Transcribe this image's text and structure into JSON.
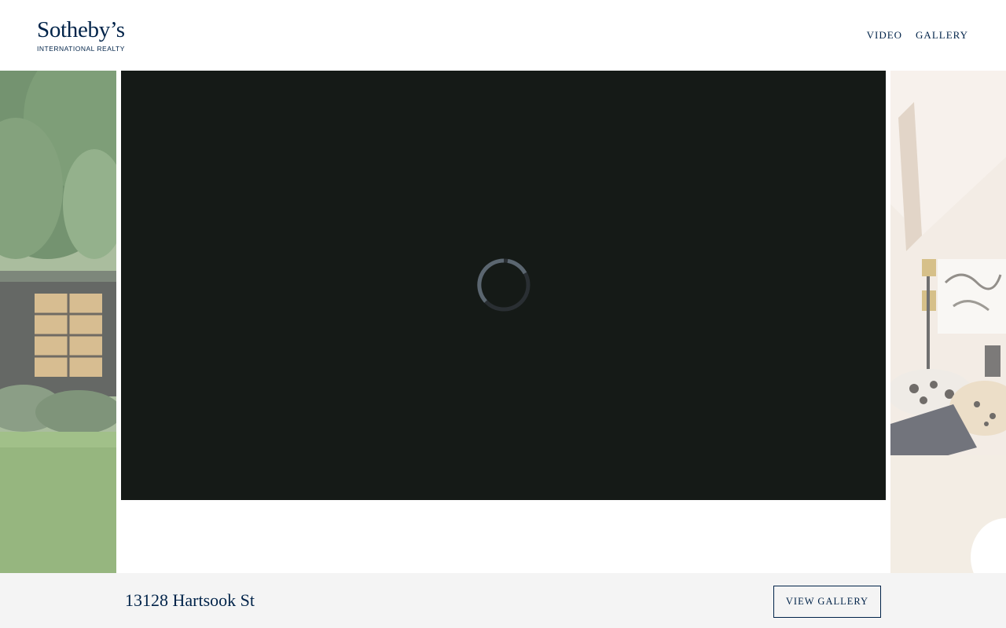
{
  "header": {
    "logo_main": "Sotheby’s",
    "logo_sub": "INTERNATIONAL REALTY",
    "nav": [
      {
        "label": "VIDEO"
      },
      {
        "label": "GALLERY"
      }
    ]
  },
  "video": {
    "state": "loading",
    "spinner_icon": "loading-spinner-icon"
  },
  "side_images": {
    "left": "exterior-garden-photo",
    "right": "interior-living-room-photo"
  },
  "footer": {
    "address": "13128 Hartsook St",
    "view_gallery_label": "VIEW GALLERY"
  },
  "colors": {
    "brand": "#002349",
    "video_bg": "#151a17",
    "footer_bg": "#f4f4f4"
  }
}
